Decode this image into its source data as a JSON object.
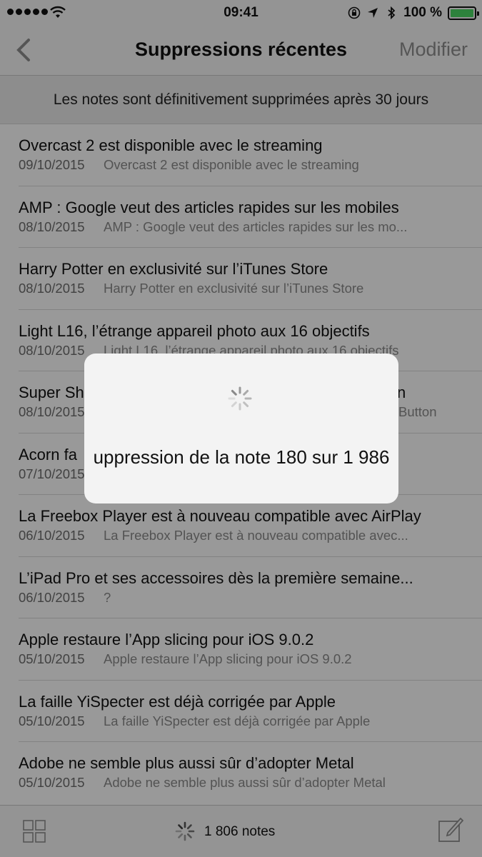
{
  "status_bar": {
    "time": "09:41",
    "battery_percent": "100 %",
    "battery_level": 1.0,
    "battery_color": "#4cd964",
    "icons": [
      "signal-dots-icon",
      "wifi-icon",
      "orientation-lock-icon",
      "location-arrow-icon",
      "bluetooth-icon",
      "battery-icon"
    ]
  },
  "nav": {
    "back_icon": "chevron-left-icon",
    "title": "Suppressions récentes",
    "edit_label": "Modifier"
  },
  "banner": {
    "text": "Les notes sont définitivement supprimées après 30 jours"
  },
  "notes": [
    {
      "title": "Overcast 2 est disponible avec le streaming",
      "date": "09/10/2015",
      "preview": "Overcast 2 est disponible avec le streaming"
    },
    {
      "title": "AMP : Google veut des articles rapides sur les mobiles",
      "date": "08/10/2015",
      "preview": "AMP : Google veut des articles rapides sur les mo..."
    },
    {
      "title": "Harry Potter en exclusivité sur l’iTunes Store",
      "date": "08/10/2015",
      "preview": "Harry Potter en exclusivité sur l’iTunes Store"
    },
    {
      "title": "Light L16, l’étrange appareil photo aux 16 objectifs",
      "date": "08/10/2015",
      "preview": "Light L16, l’étrange appareil photo aux 16 objectifs"
    },
    {
      "title": "Super Sh",
      "title_end": "n",
      "date": "08/10/2015",
      "preview": "Button"
    },
    {
      "title": "Acorn fa",
      "date": "07/10/2015",
      "preview": ""
    },
    {
      "title": "La Freebox Player est à nouveau compatible avec AirPlay",
      "date": "06/10/2015",
      "preview": "La Freebox Player est à nouveau compatible avec..."
    },
    {
      "title": "L’iPad Pro et ses accessoires dès la première semaine...",
      "date": "06/10/2015",
      "preview": "?"
    },
    {
      "title": "Apple restaure l’App slicing pour iOS 9.0.2",
      "date": "05/10/2015",
      "preview": "Apple restaure l’App slicing pour iOS 9.0.2"
    },
    {
      "title": "La faille YiSpecter est déjà corrigée par Apple",
      "date": "05/10/2015",
      "preview": "La faille YiSpecter est déjà corrigée par Apple"
    },
    {
      "title": "Adobe ne semble plus aussi sûr d’adopter Metal",
      "date": "05/10/2015",
      "preview": "Adobe ne semble plus aussi sûr d’adopter Metal"
    }
  ],
  "toolbar": {
    "grid_icon": "gallery-grid-icon",
    "count": "1 806 notes",
    "compose_icon": "compose-icon"
  },
  "dialog": {
    "message": "uppression de la note 180 sur 1 986",
    "spinner_icon": "activity-spinner-icon"
  }
}
